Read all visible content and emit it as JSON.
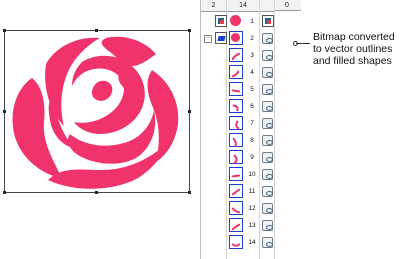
{
  "colors": {
    "rose": "#f0336a",
    "select_border": "#1b3fd6"
  },
  "panel": {
    "header": {
      "col1": "2",
      "col2": "14",
      "col3": "0"
    },
    "rows": [
      {
        "num": "1"
      },
      {
        "num": "2"
      },
      {
        "num": "3"
      },
      {
        "num": "4"
      },
      {
        "num": "5"
      },
      {
        "num": "6"
      },
      {
        "num": "7"
      },
      {
        "num": "8"
      },
      {
        "num": "9"
      },
      {
        "num": "10"
      },
      {
        "num": "11"
      },
      {
        "num": "12"
      },
      {
        "num": "13"
      },
      {
        "num": "14"
      }
    ]
  },
  "callout": {
    "line1": "Bitmap converted",
    "line2": "to vector outlines",
    "line3": "and filled shapes"
  },
  "icons": {
    "bitmap": "image-icon",
    "vector": "vector-object-icon"
  }
}
